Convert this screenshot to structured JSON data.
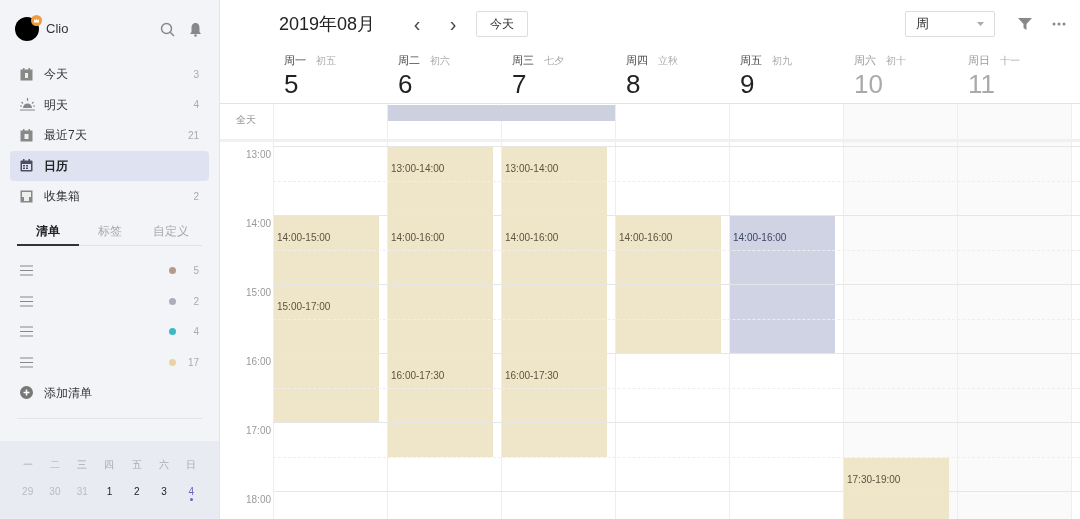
{
  "user": {
    "name": "Clio"
  },
  "nav": [
    {
      "kind": "today",
      "label": "今天",
      "count": "3",
      "selected": false
    },
    {
      "kind": "tomorrow",
      "label": "明天",
      "count": "4",
      "selected": false
    },
    {
      "kind": "week",
      "label": "最近7天",
      "count": "21",
      "selected": false
    },
    {
      "kind": "calendar",
      "label": "日历",
      "selected": true
    },
    {
      "kind": "inbox",
      "label": "收集箱",
      "count": "2",
      "selected": false
    }
  ],
  "sidebar_tabs": [
    {
      "label": "清单",
      "selected": true
    },
    {
      "label": "标签",
      "selected": false
    },
    {
      "label": "自定义",
      "selected": false
    }
  ],
  "lists": [
    {
      "color": "#b49a8c",
      "count": "5"
    },
    {
      "color": "#aeaabf",
      "count": "2"
    },
    {
      "color": "#3bbac4",
      "count": "4"
    },
    {
      "color": "#e8d4a2",
      "count": "17"
    }
  ],
  "add_list": "添加清单",
  "mini_calendar": {
    "weekdays": [
      "一",
      "二",
      "三",
      "四",
      "五",
      "六",
      "日"
    ],
    "days": [
      {
        "label": "29",
        "muted": true,
        "today": false
      },
      {
        "label": "30",
        "muted": true,
        "today": false
      },
      {
        "label": "31",
        "muted": true,
        "today": false
      },
      {
        "label": "1",
        "muted": false,
        "today": false
      },
      {
        "label": "2",
        "muted": false,
        "today": false
      },
      {
        "label": "3",
        "muted": false,
        "today": false
      },
      {
        "label": "4",
        "muted": false,
        "today": true
      }
    ]
  },
  "toolbar": {
    "title": "2019年08月",
    "prev": "‹",
    "next": "›",
    "today_button": "今天",
    "view": "周"
  },
  "days": [
    {
      "weekday": "周一",
      "lunar": "初五",
      "date": "5",
      "weekend": false,
      "events": [
        {
          "label": "14:00-15:00",
          "color": "#efe6c9"
        },
        {
          "label": "15:00-17:00",
          "color": "#efe6c9"
        }
      ]
    },
    {
      "weekday": "周二",
      "lunar": "初六",
      "date": "6",
      "weekend": false,
      "events": [
        {
          "label": "13:00-14:00",
          "color": "#efe6c9"
        },
        {
          "label": "14:00-16:00",
          "color": "#efe6c9"
        },
        {
          "label": "16:00-17:30",
          "color": "#efe6c9"
        }
      ]
    },
    {
      "weekday": "周三",
      "lunar": "七夕",
      "date": "7",
      "weekend": false,
      "events": [
        {
          "label": "13:00-14:00",
          "color": "#efe6c9"
        },
        {
          "label": "14:00-16:00",
          "color": "#efe6c9"
        },
        {
          "label": "16:00-17:30",
          "color": "#efe6c9"
        }
      ]
    },
    {
      "weekday": "周四",
      "lunar": "立秋",
      "date": "8",
      "weekend": false,
      "events": [
        {
          "label": "14:00-16:00",
          "color": "#efe6c9"
        }
      ]
    },
    {
      "weekday": "周五",
      "lunar": "初九",
      "date": "9",
      "weekend": false,
      "events": [
        {
          "label": "14:00-16:00",
          "color": "#cfd3e3"
        }
      ]
    },
    {
      "weekday": "周六",
      "lunar": "初十",
      "date": "10",
      "weekend": true,
      "events": [
        {
          "label": "17:30-19:00",
          "color": "#efe6c9"
        }
      ]
    },
    {
      "weekday": "周日",
      "lunar": "十一",
      "date": "11",
      "weekend": true
    }
  ],
  "all_day_label": "全天",
  "hours": [
    "13:00",
    "14:00",
    "15:00",
    "16:00",
    "17:00",
    "18:00"
  ]
}
